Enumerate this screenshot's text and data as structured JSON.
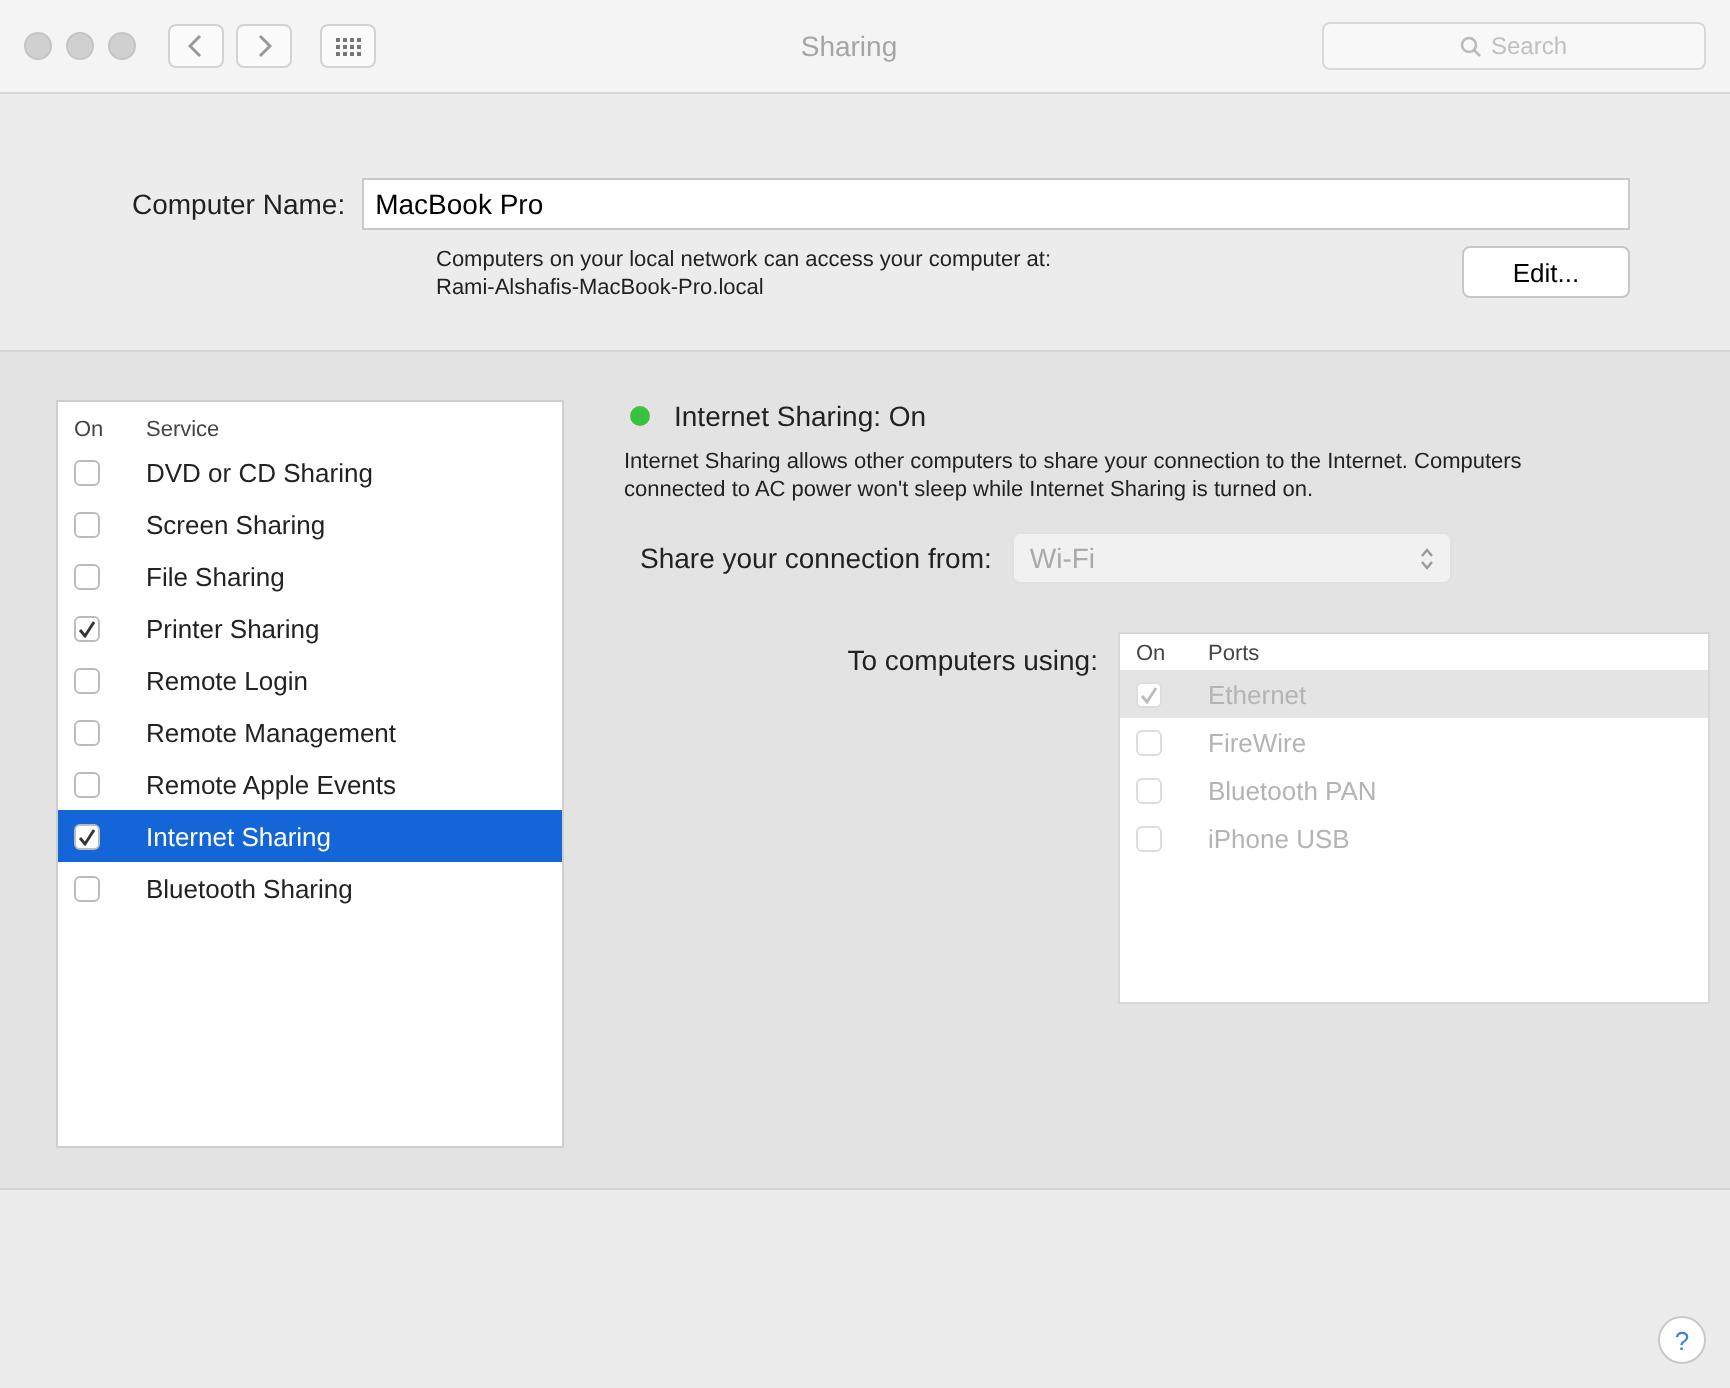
{
  "window": {
    "title": "Sharing",
    "search": {
      "placeholder": "Search"
    }
  },
  "computer_name": {
    "label": "Computer Name:",
    "value": "MacBook Pro",
    "description": "Computers on your local network can access your computer at:",
    "address": "Rami-Alshafis-MacBook-Pro.local",
    "edit_button": "Edit..."
  },
  "services": {
    "columns": [
      "On",
      "Service"
    ],
    "rows": [
      {
        "name": "DVD or CD Sharing",
        "checked": false,
        "selected": false
      },
      {
        "name": "Screen Sharing",
        "checked": false,
        "selected": false
      },
      {
        "name": "File Sharing",
        "checked": false,
        "selected": false
      },
      {
        "name": "Printer Sharing",
        "checked": true,
        "selected": false
      },
      {
        "name": "Remote Login",
        "checked": false,
        "selected": false
      },
      {
        "name": "Remote Management",
        "checked": false,
        "selected": false
      },
      {
        "name": "Remote Apple Events",
        "checked": false,
        "selected": false
      },
      {
        "name": "Internet Sharing",
        "checked": true,
        "selected": true
      },
      {
        "name": "Bluetooth Sharing",
        "checked": false,
        "selected": false
      }
    ]
  },
  "detail": {
    "status": "Internet Sharing: On",
    "status_dot": {
      "color": "#3cc13f"
    },
    "description": "Internet Sharing allows other computers to share your connection to the Internet. Computers connected to AC power won't sleep while Internet Sharing is turned on.",
    "share_from": {
      "label": "Share your connection from:",
      "value": "Wi-Fi",
      "disabled": true
    },
    "ports": {
      "label": "To computers using:",
      "disabled": true,
      "columns": [
        "On",
        "Ports"
      ],
      "rows": [
        {
          "name": "Ethernet",
          "checked": true,
          "selected": true
        },
        {
          "name": "FireWire",
          "checked": false,
          "selected": false
        },
        {
          "name": "Bluetooth PAN",
          "checked": false,
          "selected": false
        },
        {
          "name": "iPhone USB",
          "checked": false,
          "selected": false
        }
      ]
    }
  },
  "help_button": "?"
}
